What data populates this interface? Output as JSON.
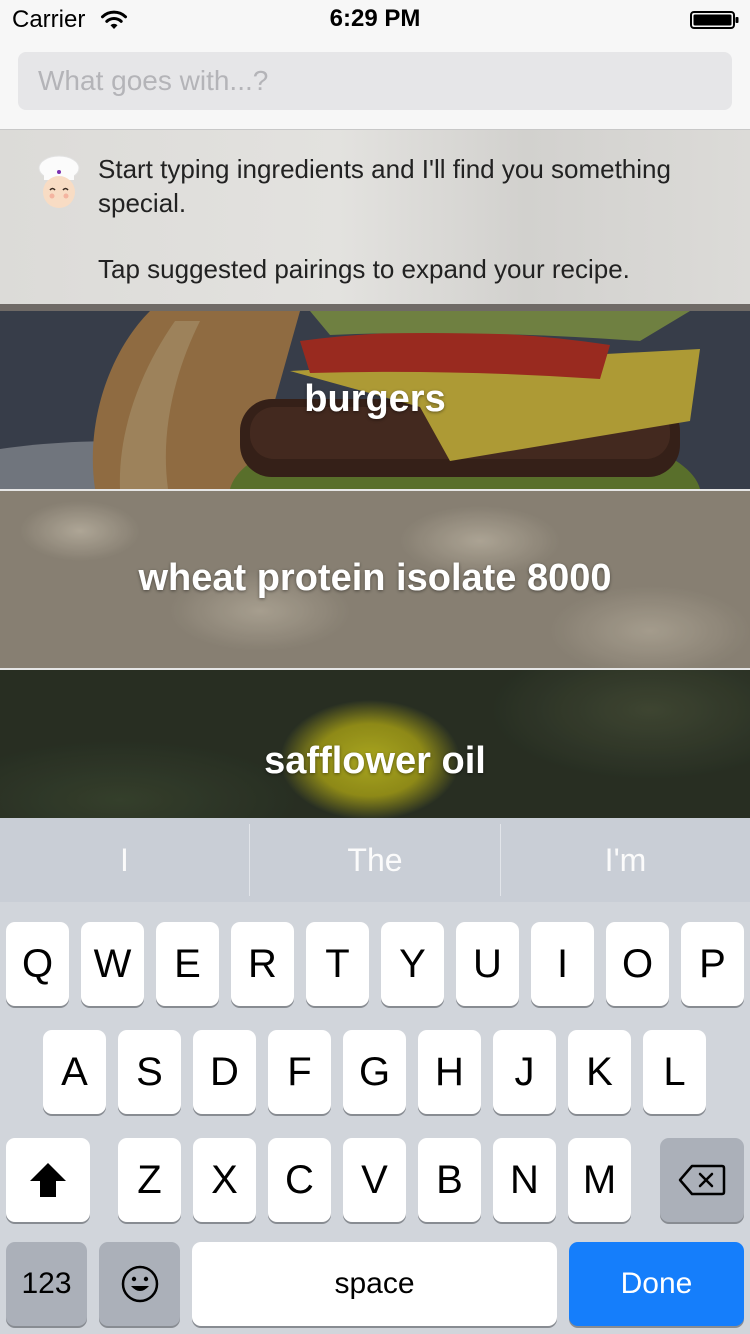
{
  "status_bar": {
    "carrier": "Carrier",
    "time": "6:29 PM"
  },
  "search": {
    "placeholder": "What goes with...?"
  },
  "info_panel": {
    "line1": "Start typing ingredients and I'll find you something special.",
    "line2": "Tap suggested pairings to expand your recipe."
  },
  "ingredients": [
    {
      "label": "burgers"
    },
    {
      "label": "wheat protein isolate 8000"
    },
    {
      "label": "safflower oil"
    }
  ],
  "predictive": [
    "I",
    "The",
    "I'm"
  ],
  "keyboard": {
    "row1": [
      "Q",
      "W",
      "E",
      "R",
      "T",
      "Y",
      "U",
      "I",
      "O",
      "P"
    ],
    "row2": [
      "A",
      "S",
      "D",
      "F",
      "G",
      "H",
      "J",
      "K",
      "L"
    ],
    "row3": [
      "Z",
      "X",
      "C",
      "V",
      "B",
      "N",
      "M"
    ],
    "numbers_label": "123",
    "space_label": "space",
    "done_label": "Done"
  },
  "colors": {
    "done_key": "#157efb",
    "keyboard_bg": "#d1d5db"
  }
}
